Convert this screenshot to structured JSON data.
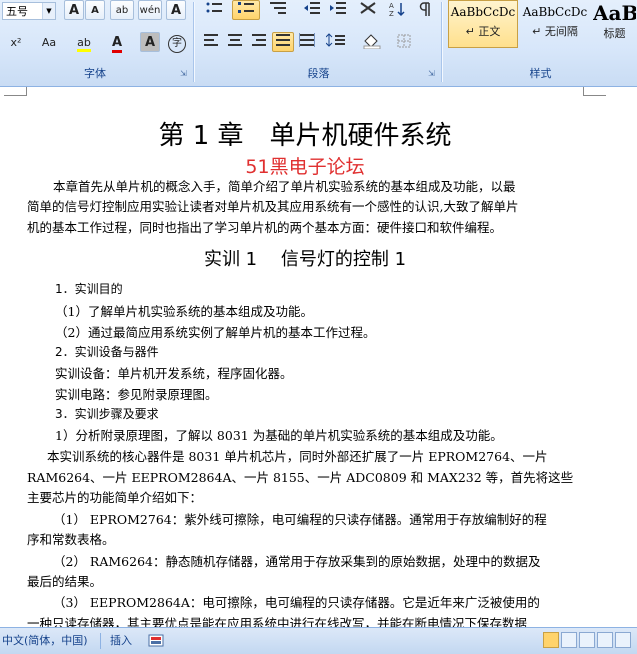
{
  "ribbon": {
    "font_group": {
      "label": "字体",
      "font_size_value": "五号",
      "grow_font": "A",
      "shrink_font": "A",
      "clear_format": "ab",
      "phonetic": "wén",
      "char_border": "A",
      "superscript": "x²",
      "change_case": "Aa",
      "highlight": "ab",
      "font_color": "A",
      "char_shading": "A",
      "enclose_char": "字"
    },
    "paragraph_group": {
      "label": "段落"
    },
    "styles_group": {
      "label": "样式",
      "styles": [
        {
          "sample": "AaBbCcDc",
          "name": "↵ 正文",
          "selected": true
        },
        {
          "sample": "AaBbCcDc",
          "name": "↵ 无间隔",
          "selected": false
        },
        {
          "sample": "AaB",
          "name": "标题",
          "selected": false
        }
      ]
    }
  },
  "document": {
    "chapter_title": "第 1 章　单片机硬件系统",
    "watermark": "51黑电子论坛",
    "intro_lines": [
      "本章首先从单片机的概念入手，简单介绍了单片机实验系统的基本组成及功能，以最",
      "简单的信号灯控制应用实验让读者对单片机及其应用系统有一个感性的认识,大致了解单片",
      "机的基本工作过程，同时也指出了学习单片机的两个基本方面：硬件接口和软件编程。"
    ],
    "section_title": "实训 1　 信号灯的控制 1",
    "lines": [
      "1．实训目的",
      "（1）了解单片机实验系统的基本组成及功能。",
      "（2）通过最简应用系统实例了解单片机的基本工作过程。",
      "2．实训设备与器件",
      "实训设备：单片机开发系统，程序固化器。",
      "实训电路：参见附录原理图。",
      "3．实训步骤及要求",
      "1）分析附录原理图，了解以 8031 为基础的单片机实验系统的基本组成及功能。",
      "本实训系统的核心器件是 8031 单片机芯片，同时外部还扩展了一片 EPROM2764、一片",
      "RAM6264、一片 EEPROM2864A、一片 8155、一片 ADC0809 和 MAX232 等，首先将这些",
      "主要芯片的功能简单介绍如下：",
      "（1） EPROM2764：紫外线可擦除，电可编程的只读存储器。通常用于存放编制好的程",
      "序和常数表格。",
      "（2） RAM6264：静态随机存储器，通常用于存放采集到的原始数据，处理中的数据及",
      "最后的结果。",
      "（3） EEPROM2864A：电可擦除，电可编程的只读存储器。它是近年来广泛被使用的",
      "一种只读存储器，其主要优点是能在应用系统中进行在线改写，并能在断电情况下保存数据"
    ]
  },
  "statusbar": {
    "language": "中文(简体，中国)",
    "mode": "插入"
  }
}
